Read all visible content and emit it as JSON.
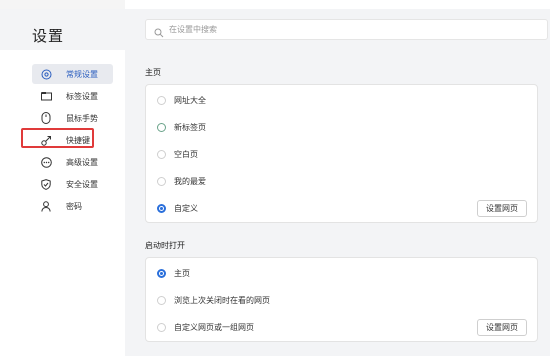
{
  "header": {
    "title": "设置",
    "search_placeholder": "在设置中搜索"
  },
  "sidebar": {
    "items": [
      {
        "label": "常规设置",
        "icon": "target-icon",
        "active": true
      },
      {
        "label": "标签设置",
        "icon": "tab-icon",
        "active": false
      },
      {
        "label": "鼠标手势",
        "icon": "mouse-icon",
        "active": false
      },
      {
        "label": "快捷键",
        "icon": "shortcut-icon",
        "active": false
      },
      {
        "label": "高级设置",
        "icon": "more-icon",
        "active": false
      },
      {
        "label": "安全设置",
        "icon": "shield-icon",
        "active": false
      },
      {
        "label": "密码",
        "icon": "user-icon",
        "active": false
      }
    ]
  },
  "homepage": {
    "title": "主页",
    "options": [
      "网址大全",
      "新标签页",
      "空白页",
      "我的最爱",
      "自定义"
    ],
    "selected": "自定义",
    "button": "设置网页"
  },
  "startup": {
    "title": "启动时打开",
    "options": [
      "主页",
      "浏览上次关闭时在看的网页",
      "自定义网页或一组网页"
    ],
    "selected": "主页",
    "button": "设置网页"
  },
  "colors": {
    "accent": "#2a6fdb",
    "highlight_border": "#e03a3a"
  }
}
